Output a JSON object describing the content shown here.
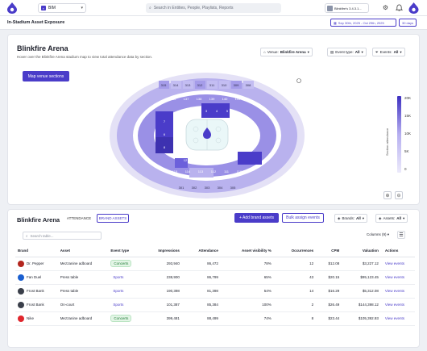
{
  "topbar": {
    "workspace": "BIM",
    "search_placeholder": "Search in Entities, People, Playlists, Reports",
    "account": "Blinkfire's 3.4.3.1...",
    "colors": {
      "brand": "#4a3cc9"
    }
  },
  "subbar": {
    "title": "In-Stadium Asset Exposure",
    "date_range": "Sep 30th, 2025 - Oct 29th, 2025",
    "days": "30 days"
  },
  "venue_card": {
    "title": "Blinkfire Arena",
    "description": "Hover over the Blinkfire Arena stadium map to view total attendance data by section.",
    "venue_filter": {
      "label": "Venue:",
      "value": "Blinkfire Arena"
    },
    "event_type_filter": {
      "label": "Event type:",
      "value": "All"
    },
    "events_filter": {
      "label": "Events:",
      "value": "All"
    },
    "map_button": "Map venue sections",
    "legend": {
      "title": "Section attendance",
      "ticks": [
        "20K",
        "15K",
        "10K",
        "5K",
        "0"
      ]
    },
    "sections": {
      "top_upper": [
        "315",
        "314",
        "313",
        "312",
        "311",
        "310",
        "309",
        "308"
      ],
      "top_lower": [
        "136",
        "137",
        "138",
        "139",
        "140",
        "141"
      ],
      "top_inner": [
        "1",
        "2",
        "3",
        "4",
        "5"
      ],
      "bottom_lower": [
        "115",
        "114",
        "113",
        "112",
        "111",
        "110"
      ],
      "bottom_inner": [
        "12",
        "13",
        "14",
        "15",
        "16"
      ],
      "bottom_upper": [
        "301",
        "302",
        "303",
        "304",
        "305"
      ],
      "left": [
        "7",
        "6",
        "8"
      ],
      "right": [
        "17",
        "18",
        "19"
      ]
    }
  },
  "brands_card": {
    "title": "Blinkfire Arena",
    "tabs": [
      "ATTENDANCE",
      "BRAND ASSETS"
    ],
    "add_button": "+ Add brand assets",
    "bulk_button": "Bulk assign events",
    "brands_filter": {
      "label": "Brands:",
      "value": "All"
    },
    "assets_filter": {
      "label": "Assets:",
      "value": "All"
    },
    "search_placeholder": "Search table...",
    "columns_label": "Columns (9)",
    "headers": [
      "Brand",
      "Asset",
      "Event type",
      "Impressions",
      "Attendance",
      "Asset visibility %",
      "Occurrences",
      "CPM",
      "Valuation",
      "Actions"
    ],
    "rows": [
      {
        "brand": "Dr. Pepper",
        "asset": "Mezzanine adboard",
        "event_type": "Concerts",
        "impressions": "293,940",
        "attendance": "86,472",
        "visibility": "78%",
        "occurrences": "12",
        "cpm": "$12.08",
        "valuation": "$3,227.12",
        "action": "View events",
        "logo_color": "#b3261e"
      },
      {
        "brand": "Fan Duel",
        "asset": "Press table",
        "event_type": "Sports",
        "impressions": "238,900",
        "attendance": "86,799",
        "visibility": "65%",
        "occurrences": "43",
        "cpm": "$20.15",
        "valuation": "$95,123.45",
        "action": "View events",
        "logo_color": "#1a5fd0"
      },
      {
        "brand": "Frost Bank",
        "asset": "Press table",
        "event_type": "Sports",
        "impressions": "190,398",
        "attendance": "81,398",
        "visibility": "54%",
        "occurrences": "14",
        "cpm": "$16.29",
        "valuation": "$5,312.08",
        "action": "View events",
        "logo_color": "#3a3f4a"
      },
      {
        "brand": "Frost Bank",
        "asset": "On-court",
        "event_type": "Sports",
        "impressions": "101,387",
        "attendance": "85,384",
        "visibility": "100%",
        "occurrences": "2",
        "cpm": "$26.49",
        "valuation": "$144,398.12",
        "action": "View events",
        "logo_color": "#3a3f4a"
      },
      {
        "brand": "Nike",
        "asset": "Mezzanine adboard",
        "event_type": "Concerts",
        "impressions": "399,481",
        "attendance": "88,499",
        "visibility": "74%",
        "occurrences": "8",
        "cpm": "$23.44",
        "valuation": "$105,392.93",
        "action": "View events",
        "logo_color": "#e0262d"
      }
    ]
  }
}
